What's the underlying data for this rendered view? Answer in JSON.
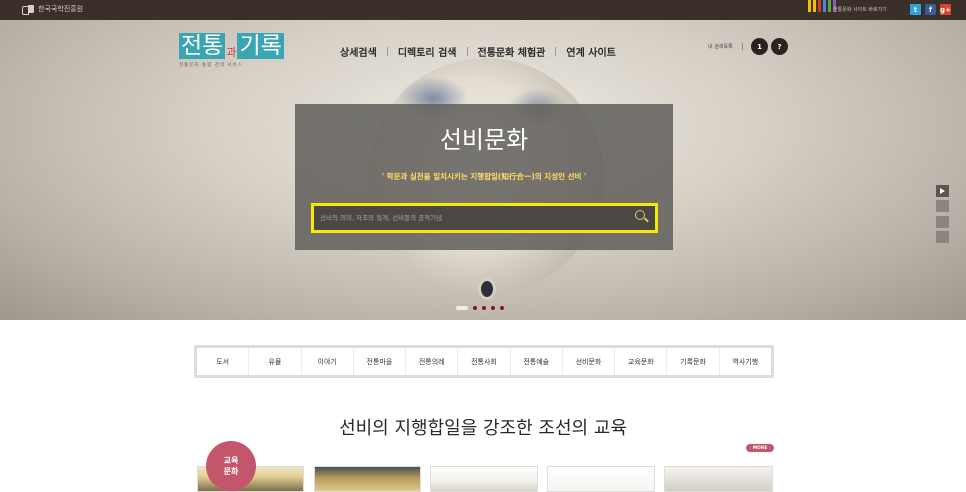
{
  "topbar": {
    "org_name": "한국국학진흥원",
    "shortcut_label": "전통문화 사이트 바로가기",
    "shortcut_bar_colors": [
      "#f2c200",
      "#f2c200",
      "#d63a2c",
      "#3f8bd6",
      "#5aa33d",
      "#8d5bb7"
    ],
    "social": [
      {
        "icon": "twitter-icon",
        "glyph": "t",
        "color": "#2ba3e1"
      },
      {
        "icon": "facebook-icon",
        "glyph": "f",
        "color": "#3b5a9a"
      },
      {
        "icon": "google-plus-icon",
        "glyph": "g+",
        "color": "#d8412f"
      }
    ]
  },
  "logo": {
    "part1": "전통",
    "middle": "과",
    "part2": "기록",
    "subtitle": "전통문화 통합 검색 서비스",
    "color_teal": "#3aa6b4",
    "color_red": "#c33c4b"
  },
  "nav": {
    "items": [
      "상세검색",
      "디렉토리 검색",
      "전통문화 체험관",
      "연계 사이트"
    ]
  },
  "header_util": {
    "my_list": "내 검색목록",
    "btn_one": "1",
    "btn_help": "?"
  },
  "hero": {
    "title": "선비문화",
    "description": "' 학문과 실천을 일치시키는 지행합일(知行合一)의 지성인 선비 '",
    "search": {
      "placeholder": "선비의 의미, 자조의 철게, 선비들의 공적기념",
      "value": "",
      "highlight_color": "#f4ea0a"
    },
    "slides_count": 5,
    "active_slide": 1
  },
  "categories": [
    "도서",
    "유물",
    "이야기",
    "전통마을",
    "전통의례",
    "전통사회",
    "전통예술",
    "선비문화",
    "교육문화",
    "기록문화",
    "역사기행"
  ],
  "section": {
    "title": "선비의 지행합일을 강조한 조선의 교육",
    "more_label": "MORE",
    "badge_line1": "교육",
    "badge_line2": "문화",
    "badge_color": "#c4566b"
  }
}
